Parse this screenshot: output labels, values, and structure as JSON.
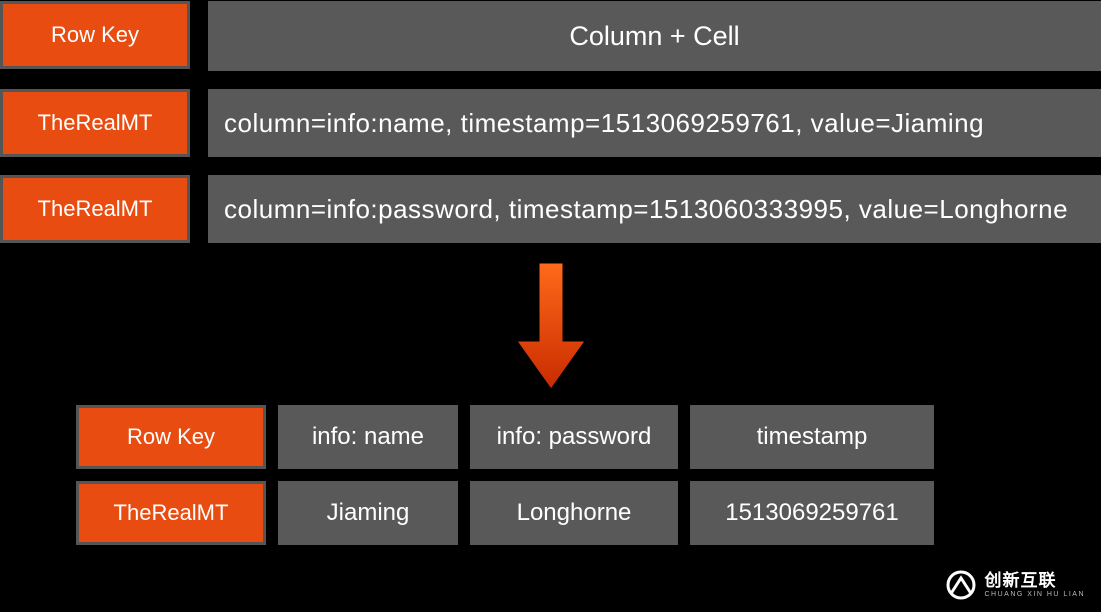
{
  "top": {
    "header": {
      "rowkey_label": "Row Key",
      "columncell_label": "Column + Cell"
    },
    "rows": [
      {
        "key": "TheRealMT",
        "cell": "column=info:name, timestamp=1513069259761, value=Jiaming"
      },
      {
        "key": "TheRealMT",
        "cell": "column=info:password, timestamp=1513060333995, value=Longhorne"
      }
    ]
  },
  "bottom": {
    "header": {
      "rowkey_label": "Row Key",
      "col1": "info: name",
      "col2": "info: password",
      "col3": "timestamp"
    },
    "row": {
      "key": "TheRealMT",
      "col1": "Jiaming",
      "col2": "Longhorne",
      "col3": "1513069259761"
    }
  },
  "logo": {
    "chinese": "创新互联",
    "pinyin": "CHUANG XIN HU LIAN"
  }
}
